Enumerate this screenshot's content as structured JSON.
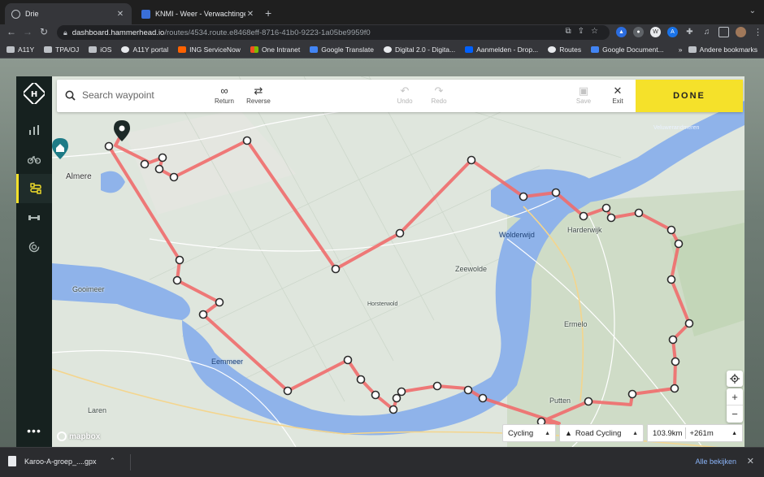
{
  "browser": {
    "tabs": [
      {
        "title": "Drie",
        "active": true
      },
      {
        "title": "KNMI - Weer - Verwachtingen",
        "active": false
      }
    ],
    "new_tab": "+",
    "url_host": "dashboard.hammerhead.io",
    "url_path": "/routes/4534.route.e8468eff-8716-41b0-9223-1a05be9959f0",
    "bookmarks": [
      "A11Y",
      "TPA/OJ",
      "iOS",
      "A11Y portal",
      "ING ServiceNow",
      "One Intranet",
      "Google Translate",
      "Digital 2.0 - Digita...",
      "Aanmelden - Drop...",
      "Routes",
      "Google Document..."
    ],
    "bookmarks_other": "Andere bookmarks"
  },
  "editor": {
    "search_placeholder": "Search waypoint",
    "return_label": "Return",
    "reverse_label": "Reverse",
    "undo_label": "Undo",
    "redo_label": "Redo",
    "save_label": "Save",
    "exit_label": "Exit",
    "done_label": "DONE"
  },
  "map": {
    "places": {
      "almere": "Almere",
      "gooimeer": "Gooimeer",
      "eemmeer": "Eemmeer",
      "wolderwijd": "Wolderwijd",
      "harderwijk": "Harderwijk",
      "zeewolde": "Zeewolde",
      "horsterwold": "Horsterwold",
      "ermelo": "Ermelo",
      "putten": "Putten",
      "laren": "Laren",
      "veluwemeer": "Veluwerandmeren"
    },
    "attribution": "mapbox",
    "route_color": "#f06b6b",
    "water_color": "#8fb3ea"
  },
  "route_footer": {
    "activity": "Cycling",
    "profile": "Road Cycling",
    "distance": "103.9km",
    "elevation": "+261m"
  },
  "downloads": {
    "file_name": "Karoo-A-groep_....gpx",
    "show_all": "Alle bekijken"
  }
}
